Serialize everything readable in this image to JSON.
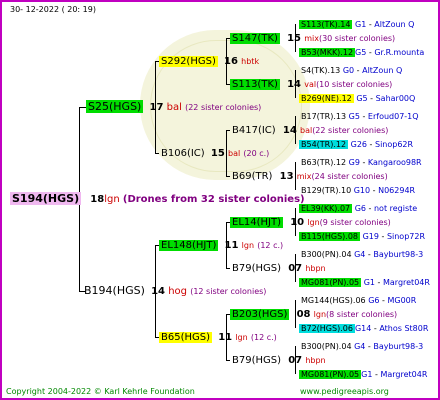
{
  "header": {
    "date": "30-  12-2022  (  20:  19)"
  },
  "footer": {
    "copyright": "Copyright 2004-2022 © Karl Kehrle Foundation",
    "site": "www.pedigreeapis.org"
  },
  "root": {
    "id": "S194(HGS)",
    "num": "18",
    "race": "lgn",
    "note": "(Drones from 32 sister colonies)"
  },
  "gen1": [
    {
      "id": "S25(HGS)",
      "num": "17",
      "race": "bal",
      "note": "(22 sister colonies)"
    },
    {
      "id": "B194(HGS)",
      "num": "14",
      "race": "hog",
      "note": "(12 sister colonies)"
    }
  ],
  "gen2": [
    {
      "id": "S292(HGS)",
      "num": "16",
      "race": "hbtk",
      "note": ""
    },
    {
      "id": "B106(IC)",
      "num": "15",
      "race": "bal",
      "note": "(20 c.)"
    },
    {
      "id": "EL148(HJT)",
      "num": "11",
      "race": "lgn",
      "note": "(12 c.)"
    },
    {
      "id": "B65(HGS)",
      "num": "11",
      "race": "lgn",
      "note": "(12 c.)"
    }
  ],
  "gen3": [
    {
      "id": "S147(TK)",
      "num": "15",
      "race": "mix",
      "note": "(30 sister colonies)"
    },
    {
      "id": "S113(TK)",
      "num": "14",
      "race": "val",
      "note": "(10 sister colonies)"
    },
    {
      "id": "B417(IC)",
      "num": "14",
      "race": "bal",
      "note": "(22 sister colonies)"
    },
    {
      "id": "B69(TR)",
      "num": "13",
      "race": "mix",
      "note": "(24 sister colonies)"
    },
    {
      "id": "EL14(HJT)",
      "num": "10",
      "race": "lgn",
      "note": "(9 sister colonies)"
    },
    {
      "id": "B79(HGS)",
      "num": "07",
      "race": "hbpn",
      "note": ""
    },
    {
      "id": "B203(HGS)",
      "num": "08",
      "race": "lgn",
      "note": "(8 sister colonies)"
    },
    {
      "id": "B79(HGS)",
      "num": "07",
      "race": "hbpn",
      "note": ""
    }
  ],
  "gen4": [
    {
      "id": "S113(TK).14",
      "gen": "G1",
      "ref": "AltZoun Q"
    },
    {
      "id": "B53(MKK).12",
      "gen": "G5",
      "ref": "Gr.R.mounta"
    },
    {
      "id": "S4(TK).13",
      "gen": "G0",
      "ref": "AltZoun Q"
    },
    {
      "id": "B269(NE).12",
      "gen": "G5",
      "ref": "Sahar00Q"
    },
    {
      "id": "B17(TR).13",
      "gen": "G5",
      "ref": "Erfoud07-1Q"
    },
    {
      "id": "B54(TR).12",
      "gen": "G26",
      "ref": "Sinop62R"
    },
    {
      "id": "B63(TR).12",
      "gen": "G9",
      "ref": "Kangaroo98R"
    },
    {
      "id": "B129(TR).10",
      "gen": "G10",
      "ref": "N06294R"
    },
    {
      "id": "EL39(KK).07",
      "gen": "G6",
      "ref": "not registe"
    },
    {
      "id": "B115(HGS).08",
      "gen": "G19",
      "ref": "Sinop72R"
    },
    {
      "id": "B300(PN).04",
      "gen": "G4",
      "ref": "Bayburt98-3"
    },
    {
      "id": "MG081(PN).05",
      "gen": "G1",
      "ref": "Margret04R"
    },
    {
      "id": "MG144(HGS).06",
      "gen": "G6",
      "ref": "MG00R"
    },
    {
      "id": "B72(HGS).06",
      "gen": "G14",
      "ref": "Athos St80R"
    },
    {
      "id": "B300(PN).04",
      "gen": "G4",
      "ref": "Bayburt98-3"
    },
    {
      "id": "MG081(PN).05",
      "gen": "G1",
      "ref": "Margret04R"
    }
  ]
}
